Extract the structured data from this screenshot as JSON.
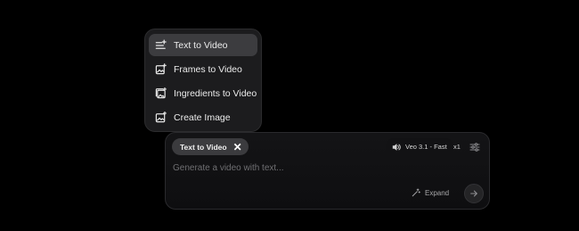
{
  "menu": {
    "items": [
      {
        "label": "Text to Video",
        "icon": "text-lines-icon",
        "active": true
      },
      {
        "label": "Frames to Video",
        "icon": "image-frame-icon",
        "active": false
      },
      {
        "label": "Ingredients to Video",
        "icon": "image-stack-icon",
        "active": false
      },
      {
        "label": "Create Image",
        "icon": "image-icon",
        "active": false
      }
    ]
  },
  "prompt": {
    "mode_chip": "Text to Video",
    "model_label": "Veo 3.1 - Fast",
    "count": "x1",
    "placeholder": "Generate a video with text...",
    "expand_label": "Expand"
  },
  "colors": {
    "background": "#000000",
    "menu_bg": "#1c1c1e",
    "active_item": "#3c3c3f",
    "chip_bg": "#3b3b3e"
  }
}
